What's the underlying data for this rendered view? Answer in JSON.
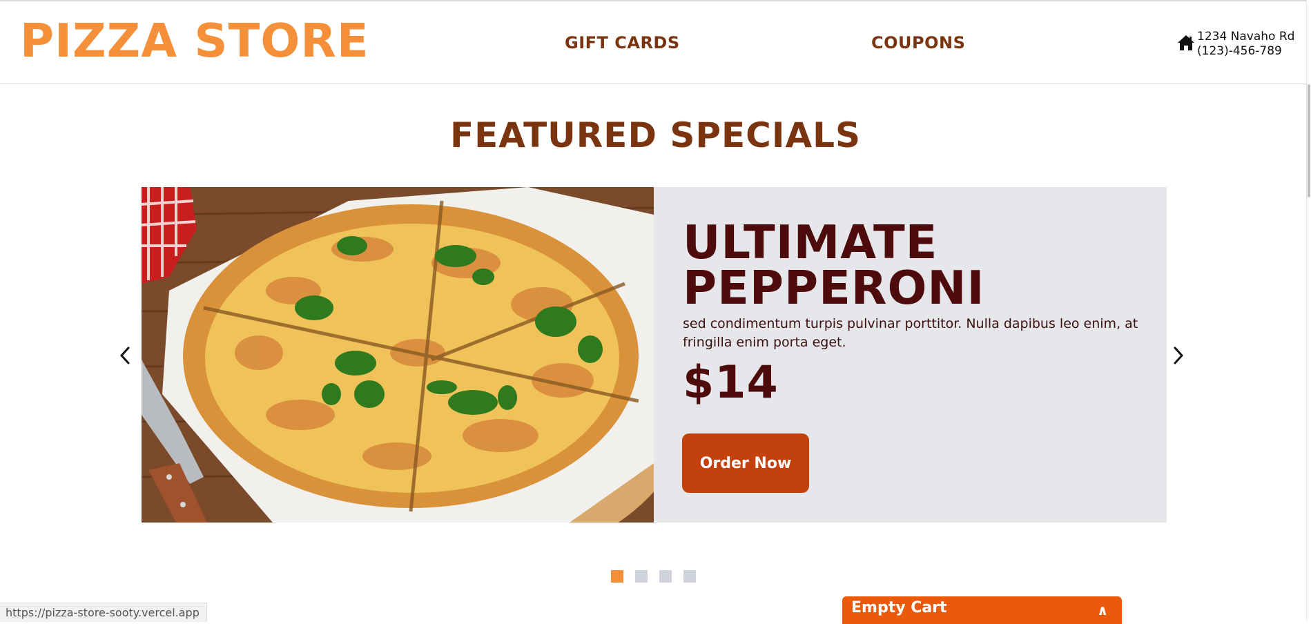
{
  "header": {
    "logo": "PIZZA STORE",
    "nav": [
      {
        "label": "GIFT CARDS"
      },
      {
        "label": "COUPONS"
      }
    ],
    "contact": {
      "icon": "home-icon",
      "address": "1234 Navaho Rd",
      "phone": "(123)-456-789"
    }
  },
  "featured": {
    "title": "FEATURED SPECIALS",
    "slide": {
      "image": "pepperoni-pizza-photo",
      "name": "ULTIMATE PEPPERONI",
      "description": "sed condimentum turpis pulvinar porttitor. Nulla dapibus leo enim, at fringilla enim porta eget.",
      "price": "$14",
      "cta": "Order Now"
    },
    "prev_icon": "chevron-left-icon",
    "next_icon": "chevron-right-icon",
    "dots": {
      "count": 4,
      "active_index": 0
    }
  },
  "cart": {
    "label": "Empty Cart",
    "toggle": "∧"
  },
  "status_bar": {
    "url": "https://pizza-store-sooty.vercel.app"
  },
  "colors": {
    "logo": "#f5903a",
    "heading": "#7a3510",
    "product_text": "#4d0b0b",
    "slide_bg": "#e6e7ea",
    "order_button": "#c2410c",
    "cart_bar": "#ea5a0c",
    "dot_active": "#f5903a",
    "dot_inactive": "#d1d3dc"
  }
}
